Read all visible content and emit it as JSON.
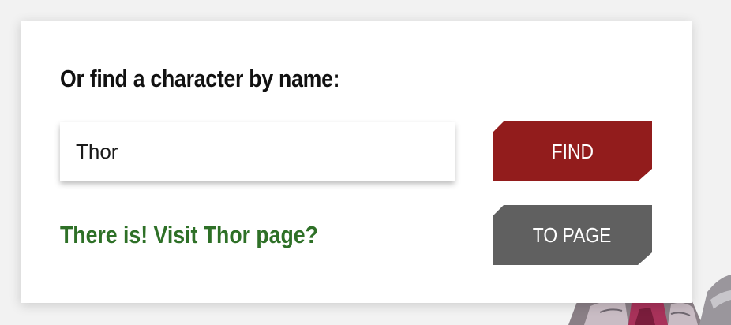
{
  "search": {
    "heading": "Or find a character by name:",
    "input_value": "Thor",
    "find_label": "FIND"
  },
  "result": {
    "message": "There is! Visit Thor page?",
    "to_page_label": "TO PAGE"
  },
  "colors": {
    "find_button": "#921c1c",
    "to_page_button": "#606060",
    "result_text": "#2e7027",
    "background": "#f2f2f2",
    "card": "#ffffff"
  }
}
